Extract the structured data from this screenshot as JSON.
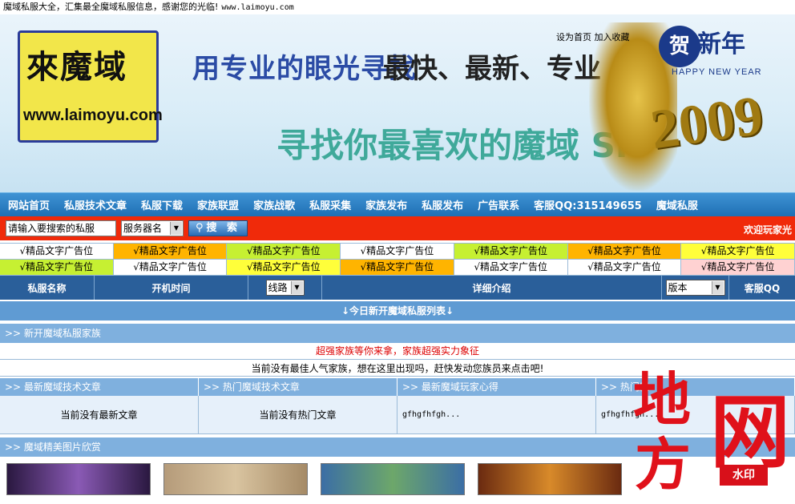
{
  "topbar": {
    "text": "魔域私服大全，汇集最全魔域私服信息，感谢您的光临!",
    "url": "www.laimoyu.com"
  },
  "banner": {
    "logo_cn": "來魔域",
    "logo_en": "www.laimoyu.com",
    "slogan1": "用专业的眼光寻找",
    "slogan1b": "最快、最新、专业",
    "slogan2": "寻找你最喜欢的魔域 SF",
    "set_home": "设为首页",
    "add_fav": "加入收藏",
    "ny_char": "贺",
    "ny_cn": "新年",
    "ny_en": "HAPPY NEW YEAR",
    "year": "2009"
  },
  "nav": [
    "网站首页",
    "私服技术文章",
    "私服下载",
    "家族联盟",
    "家族战歌",
    "私服采集",
    "家族发布",
    "私服发布",
    "广告联系",
    "客服QQ:315149655",
    "魔域私服"
  ],
  "search": {
    "input_value": "请输入要搜索的私服",
    "select_value": "服务器名",
    "button": "搜 索",
    "welcome": "欢迎玩家光"
  },
  "ads": {
    "label": "√精品文字广告位",
    "colors": [
      "#ffffff",
      "#ffb400",
      "#c6f032",
      "#ffffff",
      "#c6f032",
      "#ffb400",
      "#ffff3a",
      "#c6f032",
      "#ffffff",
      "#ffff3a",
      "#ffb400",
      "#ffffff",
      "#ffffff",
      "#ffd2d2"
    ]
  },
  "table_header": {
    "col1": "私服名称",
    "col2": "开机时间",
    "line_select": "线路",
    "col4": "详细介绍",
    "version_select": "版本",
    "col6": "客服QQ"
  },
  "today_list": "↓今日新开魔域私服列表↓",
  "family": {
    "header": ">> 新开魔域私服家族",
    "red_text": "超强家族等你来拿，家族超强实力象征",
    "call_text": "当前没有最佳人气家族，想在这里出现吗，赶快发动您族员来点击吧!"
  },
  "articles": {
    "heads": [
      ">> 最新魔域技术文章",
      ">> 热门魔域技术文章",
      ">> 最新魔域玩家心得",
      ">> 热门魔"
    ],
    "bodies": [
      "当前没有最新文章",
      "当前没有热门文章",
      "gfhgfhfgh...",
      "gfhgfhfgh..."
    ]
  },
  "gallery": {
    "header": ">> 魔域精美图片欣赏"
  },
  "watermark": {
    "char1": "地",
    "char2": "方",
    "char3": "网",
    "badge": "水印"
  }
}
